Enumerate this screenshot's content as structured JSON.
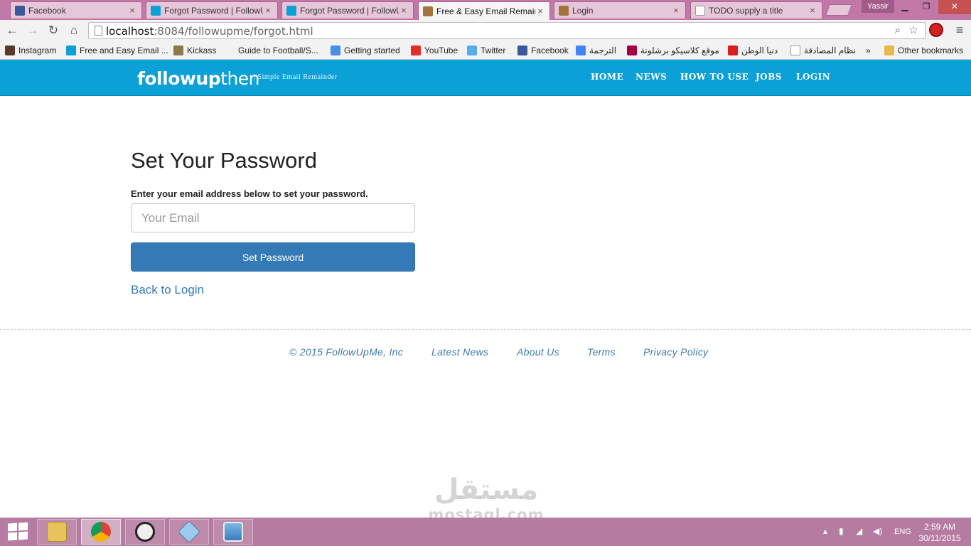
{
  "browser": {
    "profile_name": "Yassir",
    "tabs": [
      {
        "title": "Facebook",
        "icon": "facebook-icon",
        "icon_color": "#3b5998",
        "active": false
      },
      {
        "title": "Forgot Password | FollowU",
        "icon": "followup-icon",
        "icon_color": "#0ba0d6",
        "active": false
      },
      {
        "title": "Forgot Password | FollowU",
        "icon": "followup-icon",
        "icon_color": "#0ba0d6",
        "active": false
      },
      {
        "title": "Free & Easy Email Remain",
        "icon": "image-icon",
        "icon_color": "#a0743c",
        "active": true
      },
      {
        "title": "Login",
        "icon": "image-icon",
        "icon_color": "#a0743c",
        "active": false
      },
      {
        "title": "TODO supply a title",
        "icon": "page-icon",
        "icon_color": "#ffffff",
        "active": false
      }
    ],
    "url_host": "localhost",
    "url_path": ":8084/followupme/forgot.html",
    "bookmarks": [
      {
        "label": "Instagram",
        "icon": "instagram-icon",
        "color": "#5a3a2a"
      },
      {
        "label": "Free and Easy Email ...",
        "icon": "followup-icon",
        "color": "#0ba0d6"
      },
      {
        "label": "Kickass",
        "icon": "kickass-icon",
        "color": "#8a7a4a"
      },
      {
        "label": "Guide to Football/S...",
        "icon": "blank-icon",
        "color": "#f2f2f2"
      },
      {
        "label": "Getting started",
        "icon": "chrome-icon",
        "color": "#4a90e2"
      },
      {
        "label": "YouTube",
        "icon": "youtube-icon",
        "color": "#e52d27"
      },
      {
        "label": "Twitter",
        "icon": "twitter-icon",
        "color": "#55acee"
      },
      {
        "label": "Facebook",
        "icon": "facebook-icon",
        "color": "#3b5998"
      },
      {
        "label": "الترجمة",
        "icon": "translate-icon",
        "color": "#4285f4"
      },
      {
        "label": "موقع كلاسيكو برشلونة",
        "icon": "barca-icon",
        "color": "#a50044"
      },
      {
        "label": "دنيا الوطن",
        "icon": "news-icon",
        "color": "#d81e1e"
      },
      {
        "label": "نظام المصادقة",
        "icon": "page-icon",
        "color": "#ffffff"
      },
      {
        "label": "»",
        "icon": "none",
        "color": "#f2f2f2"
      },
      {
        "label": "Other bookmarks",
        "icon": "folder-icon",
        "color": "#e8b84a"
      }
    ]
  },
  "site": {
    "logo_bold": "followup",
    "logo_light": "then",
    "tagline": "| Simple Email Remainder",
    "nav": [
      "HOME",
      "NEWS",
      "HOW TO USE",
      "JOBS",
      "LOGIN"
    ]
  },
  "form": {
    "title": "Set Your Password",
    "instruction": "Enter your email address below to set your password.",
    "email_placeholder": "Your Email",
    "email_value": "",
    "submit_label": "Set Password",
    "back_link": "Back to Login"
  },
  "footer": {
    "links": [
      "© 2015 FollowUpMe, Inc",
      "Latest News",
      "About Us",
      "Terms",
      "Privacy Policy"
    ]
  },
  "watermark": {
    "arabic": "مستقل",
    "latin": "mostaql.com"
  },
  "taskbar": {
    "apps": [
      "file-explorer-icon",
      "chrome-icon",
      "eye-app-icon",
      "cube-app-icon",
      "picture-app-icon"
    ],
    "language": "ENG",
    "time": "2:59 AM",
    "date": "30/11/2015"
  }
}
